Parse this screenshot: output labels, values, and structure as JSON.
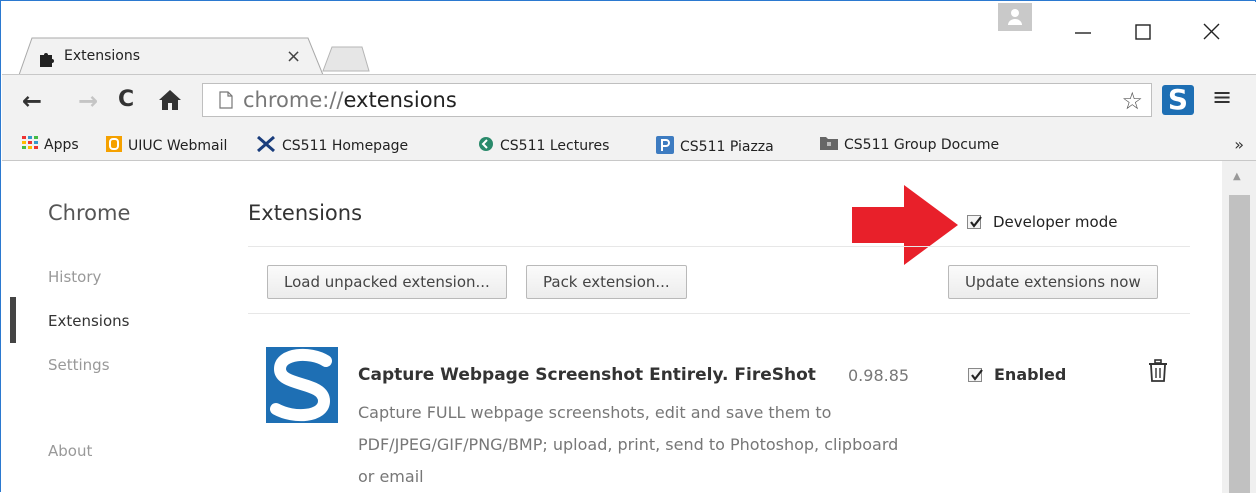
{
  "window": {
    "tab_title": "Extensions",
    "tab_close": "×",
    "minimize": "—",
    "maximize": "☐",
    "close": "✕"
  },
  "toolbar": {
    "url_scheme": "chrome://",
    "url_host": "extensions",
    "back_icon": "←",
    "forward_icon": "→",
    "reload_icon": "C",
    "home_icon": "home-icon",
    "menu_icon": "≡",
    "star_icon": "☆",
    "extension_badge": "S"
  },
  "bookmarks": {
    "items": [
      {
        "label": "Apps",
        "icon": "apps-grid-icon"
      },
      {
        "label": "UIUC Webmail",
        "icon": "office-icon"
      },
      {
        "label": "CS511 Homepage",
        "icon": "scissors-icon"
      },
      {
        "label": "CS511 Lectures",
        "icon": "circle-arrow-icon"
      },
      {
        "label": "CS511 Piazza",
        "icon": "piazza-icon"
      },
      {
        "label": "CS511 Group Docume",
        "icon": "folder-icon"
      }
    ],
    "more": "»"
  },
  "sidebar": {
    "title": "Chrome",
    "items": [
      {
        "label": "History",
        "active": false
      },
      {
        "label": "Extensions",
        "active": true
      },
      {
        "label": "Settings",
        "active": false
      },
      {
        "label": "About",
        "active": false
      }
    ]
  },
  "main": {
    "title": "Extensions",
    "developer_mode_label": "Developer mode",
    "developer_mode_checked": true,
    "buttons": {
      "load_unpacked": "Load unpacked extension...",
      "pack": "Pack extension...",
      "update": "Update extensions now"
    },
    "extension": {
      "name": "Capture Webpage Screenshot Entirely. FireShot",
      "version": "0.98.85",
      "enabled_label": "Enabled",
      "enabled": true,
      "description": "Capture FULL webpage screenshots, edit and save them to PDF/JPEG/GIF/PNG/BMP; upload, print, send to Photoshop, clipboard or email"
    }
  },
  "colors": {
    "accent_arrow": "#e8202a",
    "window_border": "#2b79d0",
    "fireshot_blue": "#1e6fb4"
  }
}
